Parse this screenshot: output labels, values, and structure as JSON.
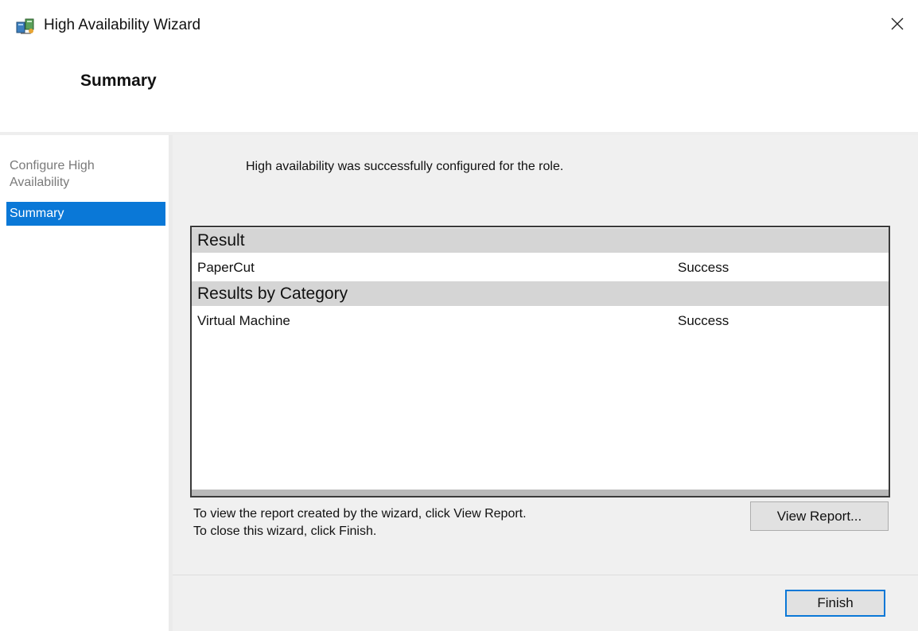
{
  "window": {
    "title": "High Availability Wizard",
    "icon": "cluster-wizard-icon",
    "close_icon": "close-icon"
  },
  "header": {
    "page_title": "Summary"
  },
  "sidebar": {
    "steps": [
      {
        "label": "Configure High Availability",
        "state": "completed"
      },
      {
        "label": "Summary",
        "state": "active"
      }
    ],
    "active_color": "#0a78d7"
  },
  "main": {
    "message": "High availability was successfully configured for the role.",
    "results": {
      "result_header": "Result",
      "result_rows": [
        {
          "name": "PaperCut",
          "status": "Success"
        }
      ],
      "category_header": "Results by Category",
      "category_rows": [
        {
          "name": "Virtual Machine",
          "status": "Success"
        }
      ]
    },
    "instructions": [
      "To view the report created by the wizard, click View Report.",
      "To close this wizard, click Finish."
    ],
    "view_report_label": "View Report..."
  },
  "footer": {
    "finish_label": "Finish"
  }
}
